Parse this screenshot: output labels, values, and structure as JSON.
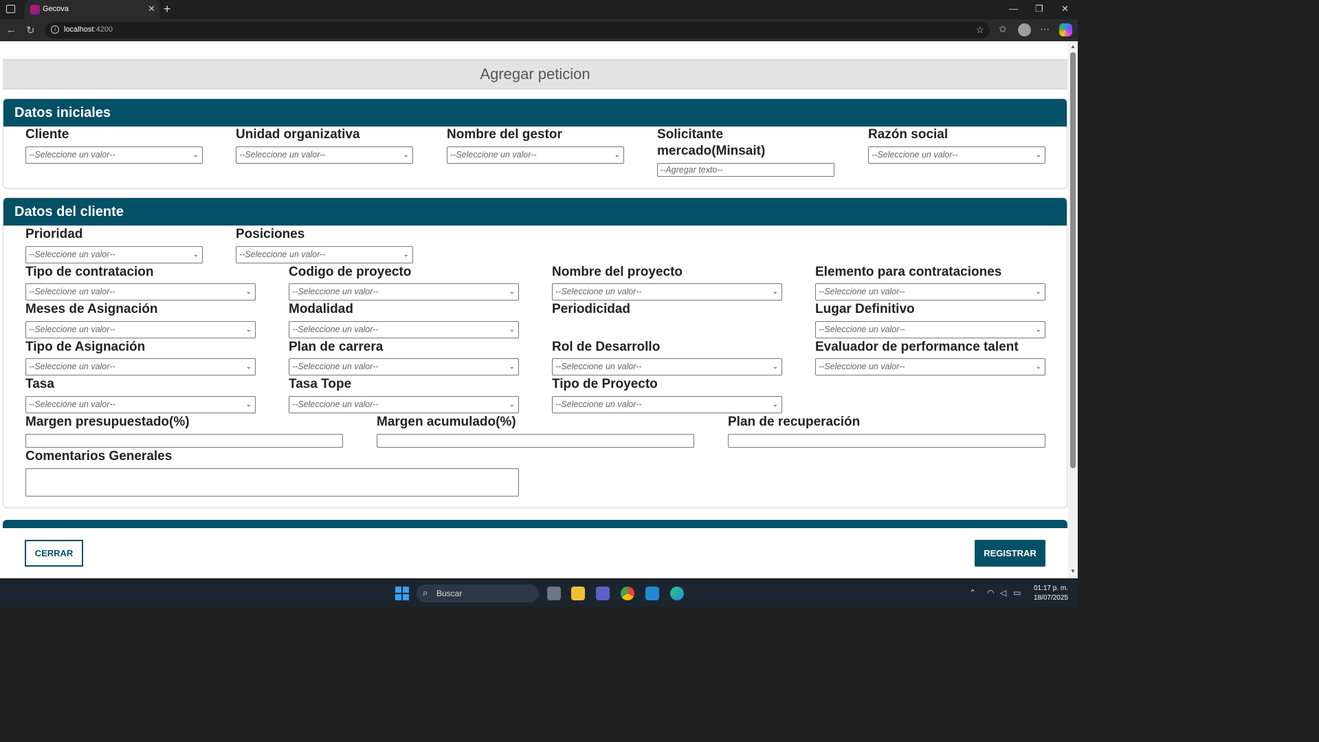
{
  "browser": {
    "tab_title": "Gecova",
    "url_host": "localhost",
    "url_port": ":4200"
  },
  "page": {
    "header_title": "Agregar peticion"
  },
  "datos_iniciales": {
    "title": "Datos iniciales",
    "cliente": {
      "label": "Cliente",
      "value": "--Seleccione un valor--"
    },
    "unidad": {
      "label": "Unidad organizativa",
      "value": "--Seleccione un valor--"
    },
    "gestor": {
      "label": "Nombre del gestor",
      "value": "--Seleccione un valor--"
    },
    "solicitante": {
      "label_line1": "Solicitante",
      "label_line2": "mercado(Minsait)",
      "placeholder": "--Agregar texto--"
    },
    "razon_social": {
      "label": "Razón social",
      "value": "--Seleccione un valor--"
    }
  },
  "datos_cliente": {
    "title": "Datos del cliente",
    "prioridad": {
      "label": "Prioridad",
      "value": "--Seleccione un valor--"
    },
    "posiciones": {
      "label": "Posiciones",
      "value": "--Seleccione un valor--"
    },
    "tipo_contratacion": {
      "label": "Tipo de contratacion",
      "value": "--Seleccione un valor--"
    },
    "codigo_proyecto": {
      "label": "Codigo de proyecto",
      "value": "--Seleccione un valor--"
    },
    "nombre_proyecto": {
      "label": "Nombre del proyecto",
      "value": "--Seleccione un valor--"
    },
    "elemento_contrataciones": {
      "label": "Elemento para contrataciones",
      "value": "--Seleccione un valor--"
    },
    "meses_asignacion": {
      "label": "Meses de Asignación",
      "value": "--Seleccione un valor--"
    },
    "modalidad": {
      "label": "Modalidad",
      "value": "--Seleccione un valor--"
    },
    "periodicidad": {
      "label": "Periodicidad"
    },
    "lugar_definitivo": {
      "label": "Lugar Definitivo",
      "value": "--Seleccione un valor--"
    },
    "tipo_asignacion": {
      "label": "Tipo de Asignación",
      "value": "--Seleccione un valor--"
    },
    "plan_carrera": {
      "label": "Plan de carrera",
      "value": "--Seleccione un valor--"
    },
    "rol_desarrollo": {
      "label": "Rol de Desarrollo",
      "value": "--Seleccione un valor--"
    },
    "evaluador": {
      "label": "Evaluador de performance talent",
      "value": "--Seleccione un valor--"
    },
    "tasa": {
      "label": "Tasa",
      "value": "--Seleccione un valor--"
    },
    "tasa_tope": {
      "label": "Tasa Tope",
      "value": "--Seleccione un valor--"
    },
    "tipo_proyecto": {
      "label": "Tipo de Proyecto",
      "value": "--Seleccione un valor--"
    },
    "margen_presupuestado": {
      "label": "Margen presupuestado(%)",
      "value": ""
    },
    "margen_acumulado": {
      "label": "Margen acumulado(%)",
      "value": ""
    },
    "plan_recuperacion": {
      "label": "Plan de recuperación",
      "value": ""
    },
    "comentarios": {
      "label": "Comentarios Generales",
      "value": ""
    }
  },
  "footer": {
    "cerrar_label": "CERRAR",
    "registrar_label": "REGISTRAR"
  },
  "taskbar": {
    "search_placeholder": "Buscar",
    "time": "01:17 p. m.",
    "date": "18/07/2025"
  },
  "colors": {
    "accent": "#045066",
    "header_bg": "#e3e3e3"
  }
}
